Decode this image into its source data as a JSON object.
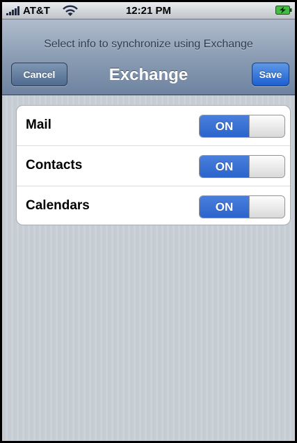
{
  "status_bar": {
    "carrier": "AT&T",
    "time": "12:21 PM",
    "icons": [
      "signal-icon",
      "wifi-icon",
      "battery-charging-icon"
    ]
  },
  "nav": {
    "prompt": "Select info to synchronize using Exchange",
    "title": "Exchange",
    "cancel_label": "Cancel",
    "save_label": "Save"
  },
  "settings": [
    {
      "label": "Mail",
      "toggle": "ON"
    },
    {
      "label": "Contacts",
      "toggle": "ON"
    },
    {
      "label": "Calendars",
      "toggle": "ON"
    }
  ],
  "colors": {
    "toggle_on": "#2f6bd2",
    "save_button": "#2a66d6",
    "nav_bar": "#7e91ab",
    "background": "#c5ccd4"
  }
}
